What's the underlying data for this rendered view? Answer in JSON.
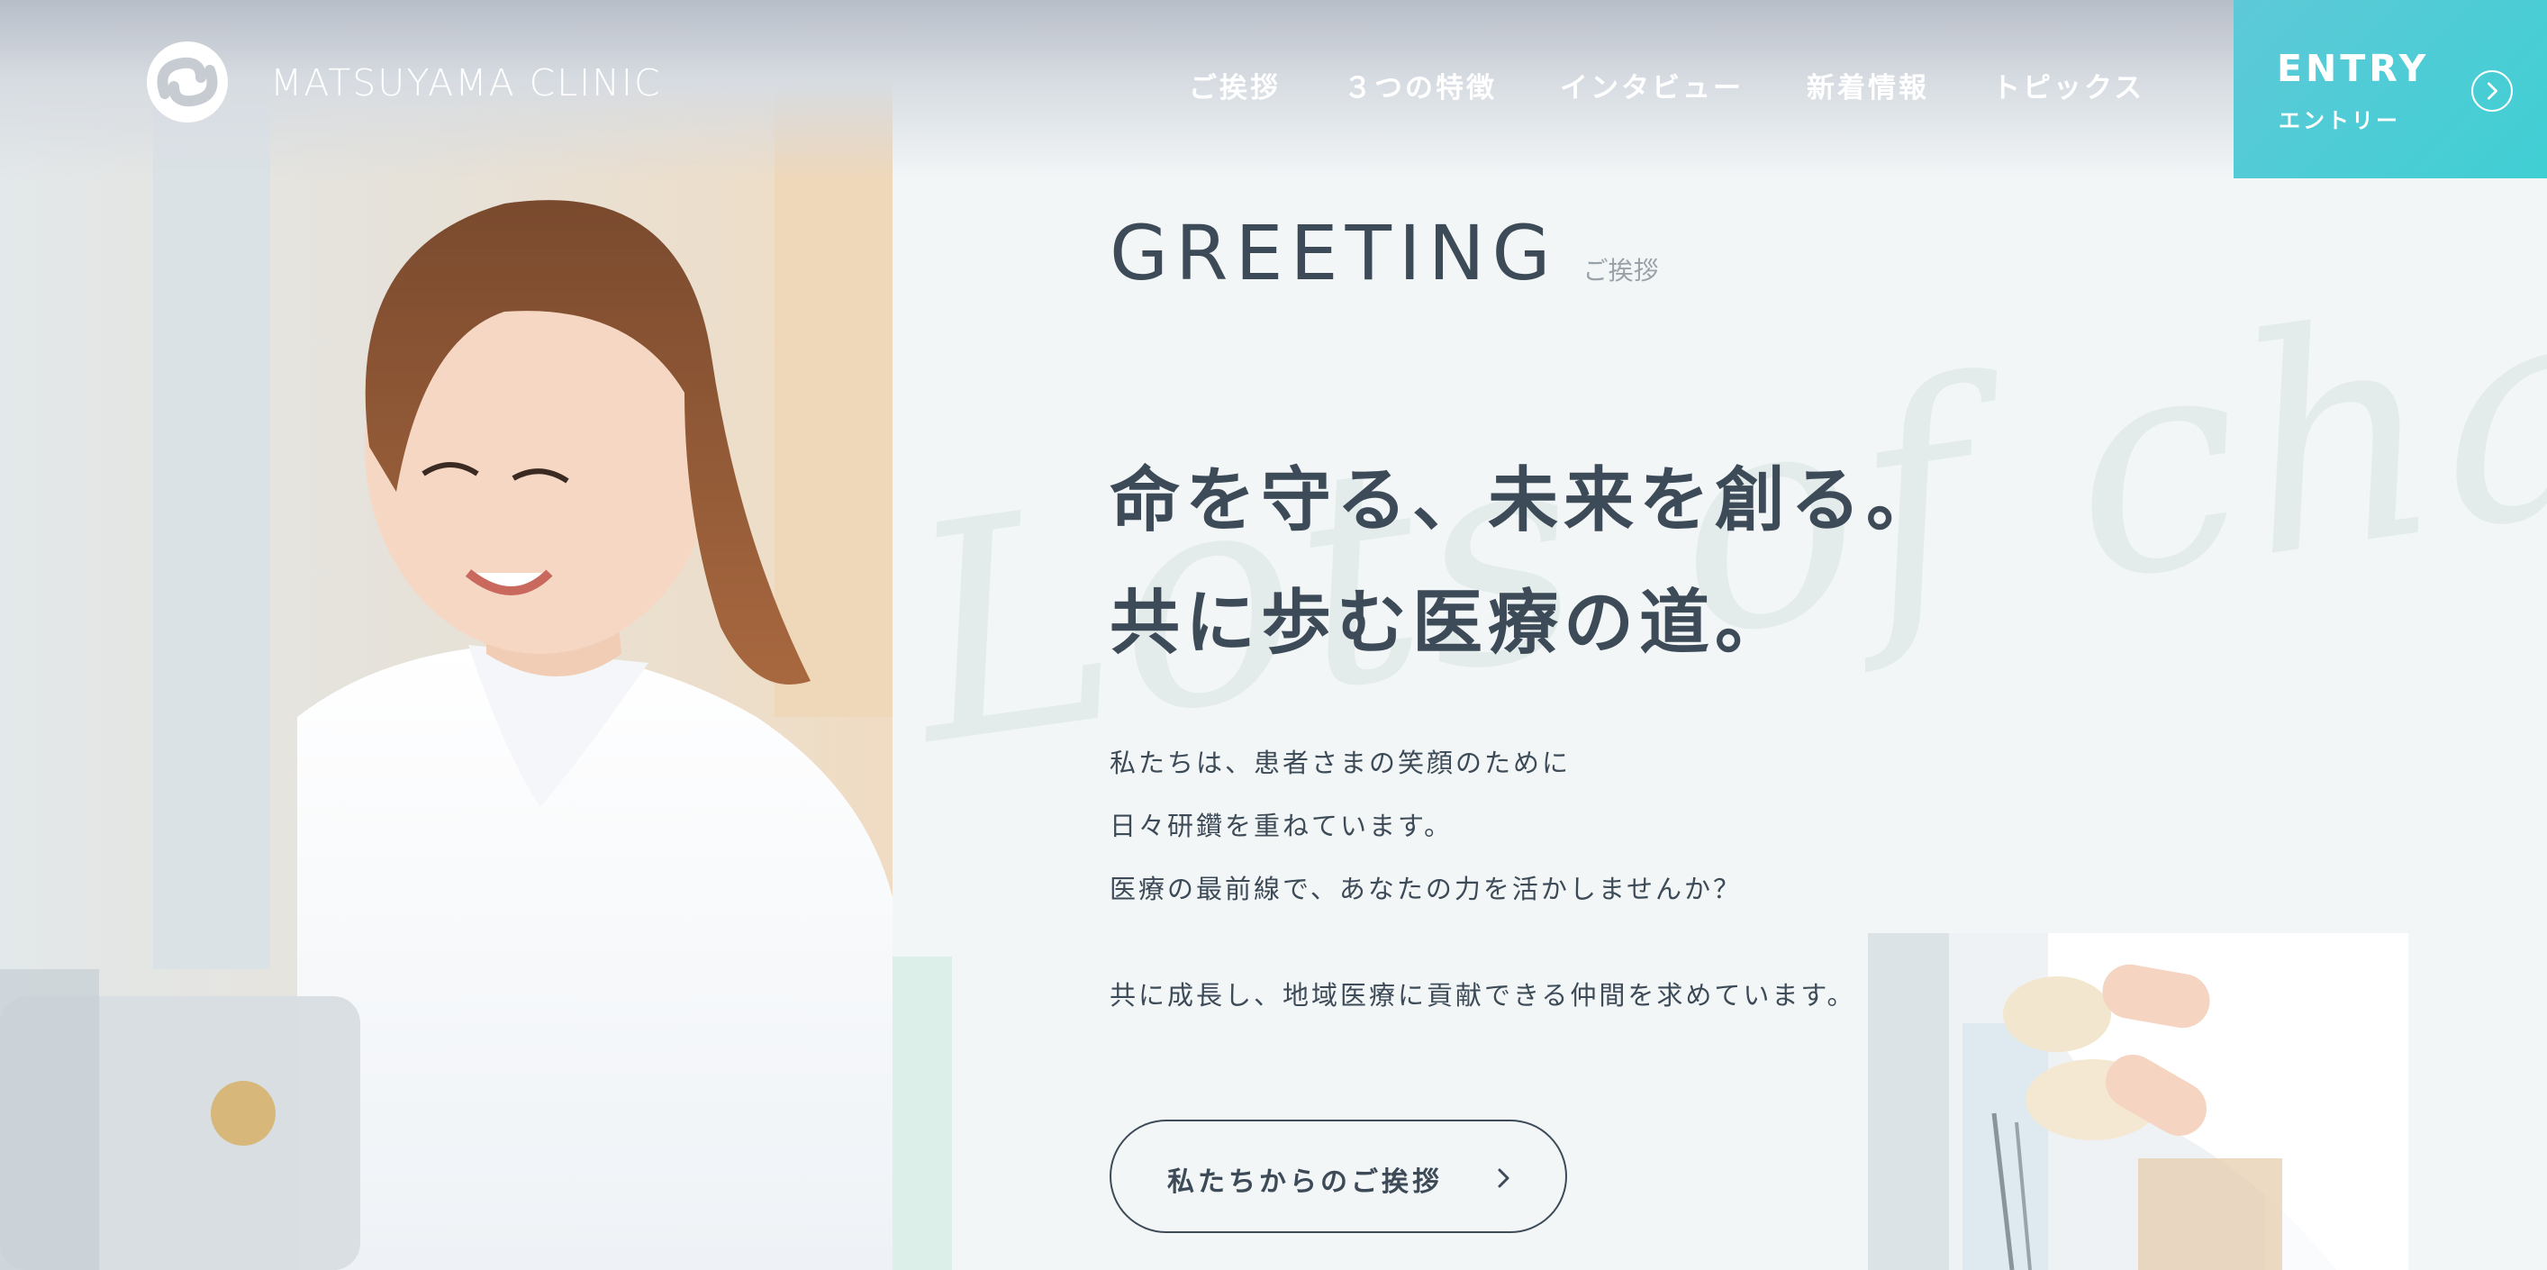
{
  "header": {
    "logo_text": "MATSUYAMA CLINIC",
    "nav": [
      {
        "label": "ご挨拶"
      },
      {
        "label": "３つの特徴"
      },
      {
        "label": "インタビュー"
      },
      {
        "label": "新着情報"
      },
      {
        "label": "トピックス"
      }
    ],
    "entry": {
      "label_en": "ENTRY",
      "label_ja": "エントリー"
    }
  },
  "greeting": {
    "title_en": "GREETING",
    "title_ja": "ご挨拶",
    "headline": [
      "命を守る、未来を創る。",
      "共に歩む医療の道。"
    ],
    "body": [
      "私たちは、患者さまの笑顔のために",
      "日々研鑽を重ねています。",
      "医療の最前線で、あなたの力を活かしませんか？",
      "共に成長し、地域医療に貢献できる仲間を求めています。"
    ],
    "button_label": "私たちからのご挨拶",
    "watermark": "Lots of challen"
  },
  "colors": {
    "accent": "#40cdd4",
    "text": "#3d4a57",
    "background": "#f2f6f7",
    "mint": "#dcefe9"
  },
  "icons": {
    "logo": "logo-mark-icon",
    "entry_arrow": "chevron-right-circle-icon",
    "cta_arrow": "chevron-right-icon"
  }
}
